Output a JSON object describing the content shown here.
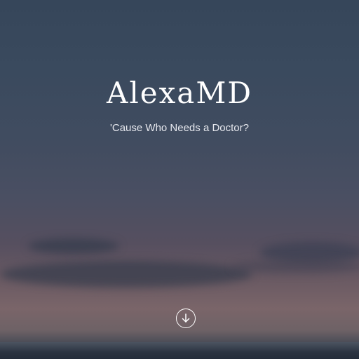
{
  "hero": {
    "title": "AlexaMD",
    "tagline": "'Cause Who Needs a Doctor?",
    "scroll_icon": "arrow-down-circle-icon"
  },
  "colors": {
    "text": "#ffffff",
    "sky_top": "#36465a",
    "sky_glow": "#7a6569"
  }
}
